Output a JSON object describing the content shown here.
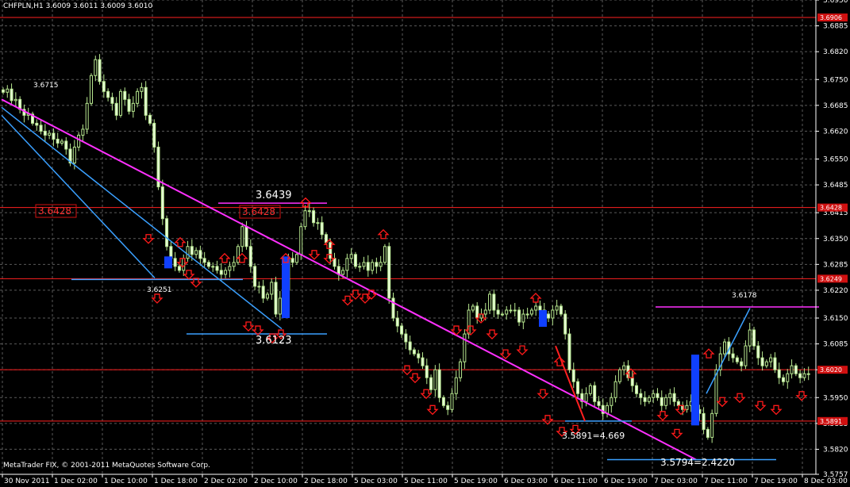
{
  "header": {
    "symbol_info": "CHFPLN,H1  3.6009 3.6011 3.6009 3.6010"
  },
  "copyright": "MetaTrader FIX, © 2001-2011 MetaQuotes Software Corp.",
  "colors": {
    "background": "#000000",
    "grid": "#5a5a5a",
    "bull_candle": "#c8f0a0",
    "bear_candle": "#e8ffd8",
    "level_line": "#ff2020",
    "trend_line": "#ff30ff",
    "channel_line": "#3aa0ff",
    "arrow": "#ff1a1a",
    "highlight": "#1040ff"
  },
  "chart_data": {
    "type": "candlestick",
    "symbol": "CHFPLN",
    "timeframe": "H1",
    "ylim": [
      3.5757,
      3.695
    ],
    "y_ticks": [
      "3.6950",
      "3.6885",
      "3.6820",
      "3.6750",
      "3.6685",
      "3.6620",
      "3.6550",
      "3.6485",
      "3.6415",
      "3.6350",
      "3.6285",
      "3.6220",
      "3.6150",
      "3.6085",
      "3.6020",
      "3.5950",
      "3.5885",
      "3.5820",
      "3.5757"
    ],
    "x_ticks": [
      "30 Nov 2011",
      "1 Dec 02:00",
      "1 Dec 10:00",
      "1 Dec 18:00",
      "2 Dec 02:00",
      "2 Dec 10:00",
      "2 Dec 18:00",
      "5 Dec 03:00",
      "5 Dec 11:00",
      "5 Dec 19:00",
      "6 Dec 03:00",
      "6 Dec 11:00",
      "6 Dec 19:00",
      "7 Dec 03:00",
      "7 Dec 11:00",
      "7 Dec 19:00",
      "8 Dec 03:00"
    ],
    "price_tags": [
      "3.6906",
      "3.6428",
      "3.6249",
      "3.6020",
      "3.5891"
    ],
    "levels": [
      3.6906,
      3.6428,
      3.6249,
      3.602,
      3.5891
    ],
    "annotations": [
      "3.6715",
      "3.6428",
      "3.6439",
      "3.6428",
      "3.6251",
      "3.6123",
      "3.6178",
      "3.5891=4.669",
      "3.5794=2.4220"
    ],
    "close": [
      3.6718,
      3.6726,
      3.6697,
      3.67,
      3.6675,
      3.666,
      3.6663,
      3.664,
      3.6635,
      3.662,
      3.661,
      3.6615,
      3.66,
      3.659,
      3.6595,
      3.6575,
      3.654,
      3.658,
      3.661,
      3.6625,
      3.669,
      3.676,
      3.68,
      3.6745,
      3.672,
      3.6705,
      3.669,
      3.666,
      3.672,
      3.67,
      3.667,
      3.669,
      3.672,
      3.673,
      3.666,
      3.664,
      3.658,
      3.648,
      3.64,
      3.633,
      3.63,
      3.628,
      3.627,
      3.63,
      3.633,
      3.631,
      3.632,
      3.63,
      3.629,
      3.628,
      3.628,
      3.627,
      3.626,
      3.627,
      3.628,
      3.629,
      3.633,
      3.638,
      3.633,
      3.628,
      3.623,
      3.623,
      3.62,
      3.621,
      3.624,
      3.616,
      3.62,
      3.622,
      3.63,
      3.629,
      3.631,
      3.638,
      3.642,
      3.642,
      3.639,
      3.639,
      3.636,
      3.634,
      3.63,
      3.628,
      3.626,
      3.627,
      3.63,
      3.631,
      3.628,
      3.628,
      3.629,
      3.627,
      3.629,
      3.628,
      3.629,
      3.633,
      3.62,
      3.615,
      3.613,
      3.611,
      3.609,
      3.607,
      3.606,
      3.605,
      3.603,
      3.6,
      3.597,
      3.602,
      3.595,
      3.593,
      3.592,
      3.596,
      3.6,
      3.604,
      3.611,
      3.617,
      3.618,
      3.615,
      3.616,
      3.617,
      3.621,
      3.617,
      3.616,
      3.616,
      3.617,
      3.617,
      3.617,
      3.614,
      3.616,
      3.616,
      3.617,
      3.618,
      3.617,
      3.616,
      3.615,
      3.617,
      3.618,
      3.616,
      3.611,
      3.602,
      3.599,
      3.596,
      3.594,
      3.596,
      3.598,
      3.594,
      3.593,
      3.591,
      3.593,
      3.595,
      3.599,
      3.602,
      3.603,
      3.6,
      3.598,
      3.596,
      3.595,
      3.594,
      3.595,
      3.596,
      3.595,
      3.593,
      3.595,
      3.596,
      3.594,
      3.593,
      3.592,
      3.593,
      3.594,
      3.592,
      3.591,
      3.587,
      3.585,
      3.591,
      3.602,
      3.606,
      3.609,
      3.606,
      3.605,
      3.604,
      3.603,
      3.608,
      3.612,
      3.608,
      3.605,
      3.603,
      3.604,
      3.605,
      3.602,
      3.6,
      3.599,
      3.601,
      3.603,
      3.601,
      3.6,
      3.601,
      3.601
    ]
  }
}
